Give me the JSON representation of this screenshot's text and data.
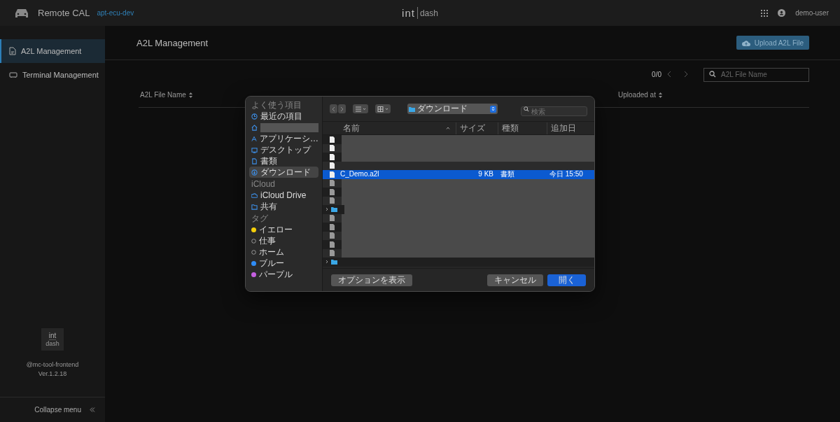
{
  "header": {
    "app_title": "Remote CAL",
    "environment": "apt-ecu-dev",
    "logo": {
      "left": "int",
      "right": "dash"
    },
    "user": "demo-user"
  },
  "sidebar": {
    "items": [
      {
        "label": "A2L Management",
        "selected": true
      },
      {
        "label": "Terminal Management",
        "selected": false
      }
    ],
    "logo": {
      "top": "int",
      "bottom": "dash"
    },
    "package": "@mc-tool-frontend",
    "version": "Ver.1.2.18",
    "collapse": "Collapse menu"
  },
  "page": {
    "title": "A2L Management",
    "upload_button": "Upload A2L File",
    "pagination": "0/0",
    "search": {
      "placeholder": "A2L File Name"
    },
    "table": {
      "columns": [
        {
          "label": "A2L File Name",
          "sortable": true
        },
        {
          "label": "Uploaded at",
          "sortable": true
        }
      ]
    }
  },
  "file_dialog": {
    "sidebar": [
      {
        "title": "よく使う項目",
        "items": [
          {
            "label": "最近の項目",
            "kind": "item",
            "selected": false
          },
          {
            "kind": "redacted",
            "selected": false
          },
          {
            "label": "アプリケーシ…",
            "kind": "item",
            "selected": false
          },
          {
            "label": "デスクトップ",
            "kind": "item",
            "selected": false
          },
          {
            "label": "書類",
            "kind": "item",
            "selected": false
          },
          {
            "label": "ダウンロード",
            "kind": "item",
            "selected": true
          }
        ]
      },
      {
        "title": "iCloud",
        "items": [
          {
            "label": "iCloud Drive",
            "kind": "item",
            "selected": false
          },
          {
            "label": "共有",
            "kind": "item",
            "selected": false
          }
        ]
      },
      {
        "title": "タグ",
        "items": [
          {
            "label": "イエロー",
            "kind": "tag",
            "color": "#f5cf0a"
          },
          {
            "label": "仕事",
            "kind": "tag"
          },
          {
            "label": "ホーム",
            "kind": "tag"
          },
          {
            "label": "ブルー",
            "kind": "tag",
            "color": "#2f8cf6"
          },
          {
            "label": "パープル",
            "kind": "tag",
            "color": "#c560e0"
          }
        ]
      }
    ],
    "location": "ダウンロード",
    "search": {
      "placeholder": "検索"
    },
    "columns": [
      "名前",
      "サイズ",
      "種類",
      "追加日"
    ],
    "rows": [
      {
        "kind": "file",
        "selected": false,
        "redacted": true
      },
      {
        "kind": "file",
        "selected": false,
        "redacted": true
      },
      {
        "kind": "file",
        "selected": false,
        "redacted": true
      },
      {
        "kind": "file",
        "selected": false,
        "redacted": false
      },
      {
        "kind": "file",
        "selected": true,
        "redacted": false,
        "name": "C_Demo.a2l",
        "size": "9 KB",
        "type": "書類",
        "added": "今日 15:50"
      },
      {
        "kind": "file",
        "selected": false,
        "redacted": true
      },
      {
        "kind": "file",
        "selected": false,
        "redacted": true
      },
      {
        "kind": "file",
        "selected": false,
        "redacted": true
      },
      {
        "kind": "folder",
        "selected": false,
        "redacted": true
      },
      {
        "kind": "file",
        "selected": false,
        "redacted": true
      },
      {
        "kind": "file",
        "selected": false,
        "redacted": true
      },
      {
        "kind": "file",
        "selected": false,
        "redacted": true
      },
      {
        "kind": "file",
        "selected": false,
        "redacted": true
      },
      {
        "kind": "file",
        "selected": false,
        "redacted": true
      },
      {
        "kind": "folder",
        "selected": false,
        "redacted": false
      }
    ],
    "options_button": "オプションを表示",
    "cancel_button": "キャンセル",
    "open_button": "開く"
  }
}
